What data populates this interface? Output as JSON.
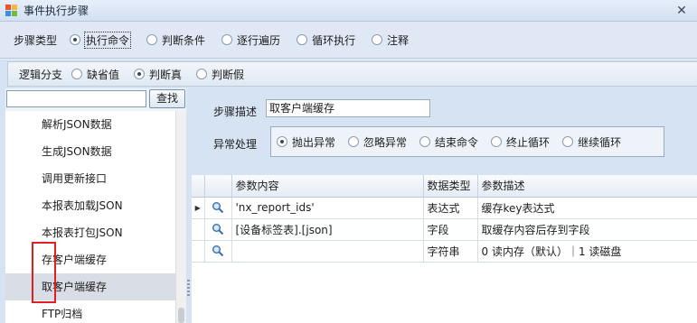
{
  "window": {
    "title": "事件执行步骤",
    "close_glyph": "✕"
  },
  "step_type": {
    "label": "步骤类型",
    "options": [
      {
        "label": "执行命令",
        "checked": true
      },
      {
        "label": "判断条件",
        "checked": false
      },
      {
        "label": "逐行遍历",
        "checked": false
      },
      {
        "label": "循环执行",
        "checked": false
      },
      {
        "label": "注释",
        "checked": false
      }
    ]
  },
  "branch": {
    "label": "逻辑分支",
    "options": [
      {
        "label": "缺省值",
        "checked": false
      },
      {
        "label": "判断真",
        "checked": true
      },
      {
        "label": "判断假",
        "checked": false
      }
    ]
  },
  "search": {
    "value": "",
    "button_label": "查找"
  },
  "tree": {
    "items": [
      {
        "label": "解析JSON数据",
        "selected": false
      },
      {
        "label": "生成JSON数据",
        "selected": false
      },
      {
        "label": "调用更新接口",
        "selected": false
      },
      {
        "label": "本报表加载JSON",
        "selected": false
      },
      {
        "label": "本报表打包JSON",
        "selected": false
      },
      {
        "label": "存客户端缓存",
        "selected": false
      },
      {
        "label": "取客户端缓存",
        "selected": true
      },
      {
        "label": "FTP归档",
        "selected": false
      }
    ]
  },
  "description": {
    "label": "步骤描述",
    "value": "取客户端缓存"
  },
  "exception": {
    "label": "异常处理",
    "options": [
      {
        "label": "抛出异常",
        "checked": true
      },
      {
        "label": "忽略异常",
        "checked": false
      },
      {
        "label": "结束命令",
        "checked": false
      },
      {
        "label": "终止循环",
        "checked": false
      },
      {
        "label": "继续循环",
        "checked": false
      }
    ]
  },
  "grid": {
    "columns": [
      "参数内容",
      "数据类型",
      "参数描述"
    ],
    "rows": [
      {
        "indicator": "▶",
        "content": "'nx_report_ids'",
        "type": "表达式",
        "desc": "缓存key表达式"
      },
      {
        "indicator": "",
        "content": "[设备标签表].[json]",
        "type": "字段",
        "desc": "取缓存内容后存到字段"
      },
      {
        "indicator": "",
        "content": "",
        "type": "字符串",
        "desc": "0 读内存（默认）｜1 读磁盘"
      }
    ]
  }
}
